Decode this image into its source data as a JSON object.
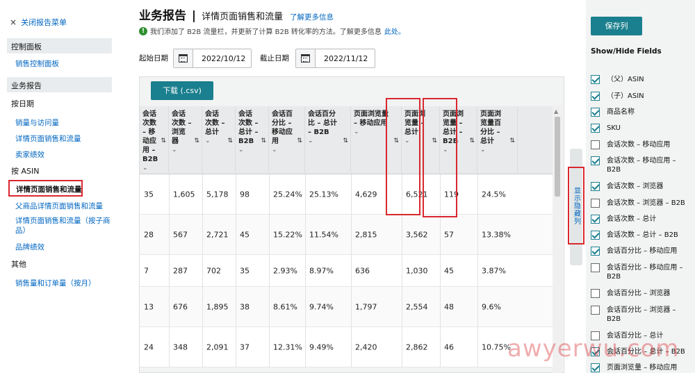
{
  "sidebar": {
    "close_label": "关闭报告菜单",
    "dashboard_header": "控制面板",
    "dashboard_link": "销售控制面板",
    "reports_header": "业务报告",
    "by_date_label": "按日期",
    "by_date_items": [
      "销量与访问量",
      "详情页面销售和流量",
      "卖家绩效"
    ],
    "by_asin_label": "按 ASIN",
    "active_item": "详情页面销售和流量",
    "by_asin_items": [
      "父商品详情页面销售和流量",
      "详情页面销售和流量（按子商品）",
      "品牌绩效"
    ],
    "other_label": "其他",
    "other_items": [
      "销售量和订单量（按月）"
    ]
  },
  "header": {
    "title": "业务报告",
    "separator": "|",
    "subtitle": "详情页面销售和流量",
    "learn_more": "了解更多信息",
    "notice": "我们添加了 B2B 流量栏，并更新了计算 B2B 转化率的方法。了解更多信息",
    "notice_link": "此处。"
  },
  "filters": {
    "start_label": "起始日期",
    "start_value": "2022/10/12",
    "end_label": "截止日期",
    "end_value": "2022/11/12"
  },
  "table": {
    "download_label": "下载 (.csv)",
    "sort_glyph": "⇅",
    "chevron_glyph": "⌄",
    "columns": [
      "会话次数 – 移动应用 – B2B",
      "会话次数 – 浏览器",
      "会话次数 – 总计",
      "会话次数 – 总计 – B2B",
      "会话百分比 – 移动应用",
      "会话百分比 – 总计 – B2B",
      "页面浏览量 – 移动应用",
      "页面浏览量 – 总计",
      "页面浏览量 – 总计 – B2B",
      "页面浏览量百分比 – 总计"
    ],
    "rows": [
      [
        "35",
        "1,605",
        "5,178",
        "98",
        "25.24%",
        "25.13%",
        "4,629",
        "6,521",
        "119",
        "24.5%"
      ],
      [
        "28",
        "567",
        "2,721",
        "45",
        "15.22%",
        "11.54%",
        "2,815",
        "3,562",
        "57",
        "13.38%"
      ],
      [
        "7",
        "287",
        "702",
        "35",
        "2.93%",
        "8.97%",
        "636",
        "1,030",
        "45",
        "3.87%"
      ],
      [
        "13",
        "676",
        "1,895",
        "38",
        "8.61%",
        "9.74%",
        "1,797",
        "2,554",
        "48",
        "9.6%"
      ],
      [
        "24",
        "348",
        "2,091",
        "37",
        "12.31%",
        "9.49%",
        "2,420",
        "2,862",
        "46",
        "10.75%"
      ]
    ],
    "show_hide_tab": "显示隐藏列"
  },
  "right_panel": {
    "save_label": "保存列",
    "title": "Show/Hide Fields",
    "fields": [
      {
        "label": "（父）ASIN",
        "checked": true
      },
      {
        "label": "（子）ASIN",
        "checked": true
      },
      {
        "label": "商品名称",
        "checked": true
      },
      {
        "label": "SKU",
        "checked": true
      },
      {
        "label": "会话次数 – 移动应用",
        "checked": false
      },
      {
        "label": "会话次数 – 移动应用 – B2B",
        "checked": true
      },
      {
        "label": "会话次数 – 浏览器",
        "checked": true
      },
      {
        "label": "会话次数 – 浏览器 – B2B",
        "checked": false
      },
      {
        "label": "会话次数 – 总计",
        "checked": true
      },
      {
        "label": "会话次数 – 总计 – B2B",
        "checked": true
      },
      {
        "label": "会话百分比 – 移动应用",
        "checked": true
      },
      {
        "label": "会话百分比 – 移动应用 – B2B",
        "checked": false
      },
      {
        "label": "会话百分比 – 浏览器",
        "checked": false
      },
      {
        "label": "会话百分比 – 浏览器 – B2B",
        "checked": false
      },
      {
        "label": "会话百分比 – 总计",
        "checked": false
      },
      {
        "label": "会话百分比 – 总计 – B2B",
        "checked": true
      },
      {
        "label": "页面浏览量 – 移动应用",
        "checked": true
      }
    ]
  },
  "watermark": "awyerwu.com",
  "colors": {
    "accent": "#1a7f8e",
    "highlight": "#d9272e",
    "link": "#0066c0"
  }
}
